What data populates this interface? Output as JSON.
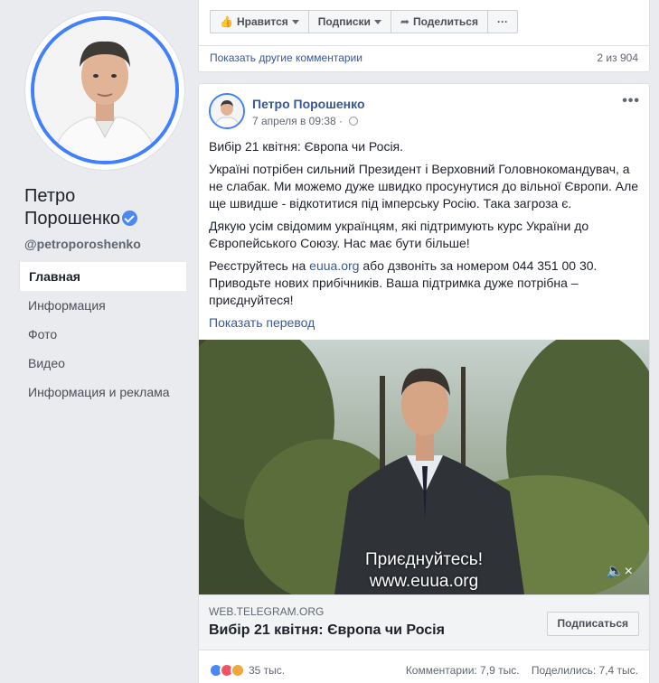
{
  "sidebar": {
    "name_line1": "Петро",
    "name_line2": "Порошенко",
    "handle": "@petroporoshenko",
    "nav": [
      {
        "label": "Главная"
      },
      {
        "label": "Информация"
      },
      {
        "label": "Фото"
      },
      {
        "label": "Видео"
      },
      {
        "label": "Информация и реклама"
      }
    ]
  },
  "prev_post": {
    "like_label": "Нравится",
    "subscriptions_label": "Подписки",
    "share_label": "Поделиться",
    "more_label": "···",
    "more_comments": "Показать другие комментарии",
    "comment_count": "2 из 904"
  },
  "post": {
    "author": "Петро Порошенко",
    "date": "7 апреля в 09:38 ·",
    "menu": "•••",
    "p1": "Вибір 21 квітня: Європа чи Росія.",
    "p2": "Україні потрібен сильний Президент і Верховний Головнокомандувач, а не слабак. Ми можемо дуже швидко просунутися до вільної Європи. Але ще швидше - відкотитися під імперську Росію. Така загроза є.",
    "p3": "Дякую усім свідомим українцям, які підтримують курс України до Європейського Союзу. Нас має бути більше!",
    "p4_pre": "Реєструйтесь на ",
    "p4_link": "euua.org",
    "p4_post": " або дзвоніть за номером 044 351 00 30. Приводьте нових прибічників. Ваша підтримка дуже потрібна – приєднуйтеся!",
    "translate": "Показать перевод",
    "video_caption_1": "Приєднуйтесь!",
    "video_caption_2": "www.euua.org",
    "link_domain": "WEB.TELEGRAM.ORG",
    "link_title": "Вибір 21 квітня: Європа чи Росія",
    "subscribe_label": "Подписаться",
    "reactions_count": "35 тыс.",
    "comments": "Комментарии: 7,9 тыс.",
    "shares": "Поделились: 7,4 тыс."
  },
  "colors": {
    "accent": "#4080ff",
    "link": "#385898",
    "background": "#e9ebee"
  }
}
